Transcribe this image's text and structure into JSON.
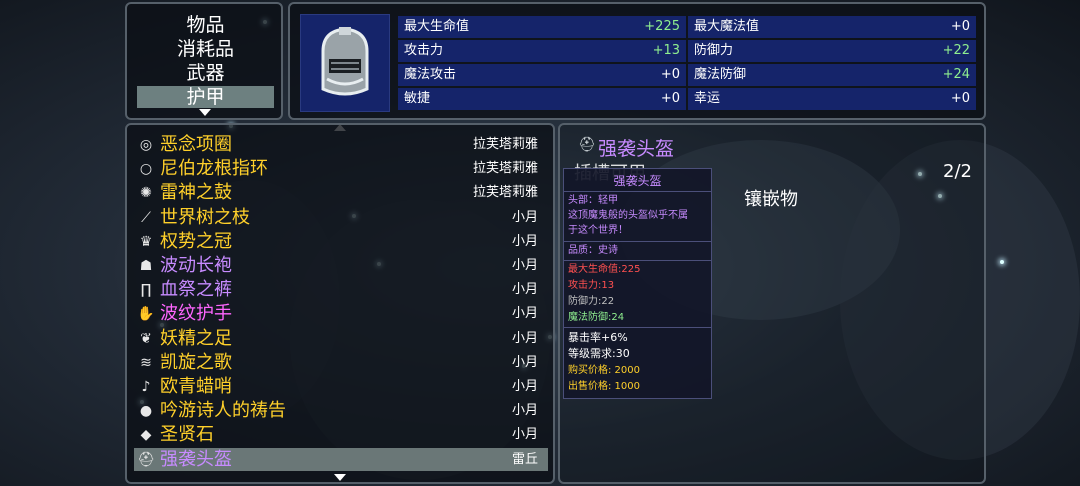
{
  "categories": {
    "items": [
      "物品",
      "消耗品",
      "武器",
      "护甲"
    ],
    "selected_index": 3
  },
  "stats": {
    "rows": [
      {
        "left_name": "最大生命值",
        "left_value": "+225",
        "right_name": "最大魔法值",
        "right_value": "+0"
      },
      {
        "left_name": "攻击力",
        "left_value": "+13",
        "right_name": "防御力",
        "right_value": "+22"
      },
      {
        "left_name": "魔法攻击",
        "left_value": "+0",
        "right_name": "魔法防御",
        "right_value": "+24"
      },
      {
        "left_name": "敏捷",
        "left_value": "+0",
        "right_name": "幸运",
        "right_value": "+0"
      }
    ]
  },
  "item_list": {
    "items": [
      {
        "name": "恶念项圈",
        "owner": "拉芙塔莉雅",
        "color": "#ffd02a",
        "icon": "collar-icon",
        "glyph": "◎"
      },
      {
        "name": "尼伯龙根指环",
        "owner": "拉芙塔莉雅",
        "color": "#ffd02a",
        "icon": "ring-icon",
        "glyph": "○"
      },
      {
        "name": "雷神之鼓",
        "owner": "拉芙塔莉雅",
        "color": "#ffd02a",
        "icon": "drum-icon",
        "glyph": "✺"
      },
      {
        "name": "世界树之枝",
        "owner": "小月",
        "color": "#ffd02a",
        "icon": "branch-icon",
        "glyph": "⟋"
      },
      {
        "name": "权势之冠",
        "owner": "小月",
        "color": "#ffd02a",
        "icon": "crown-icon",
        "glyph": "♛"
      },
      {
        "name": "波动长袍",
        "owner": "小月",
        "color": "#c78bff",
        "icon": "robe-icon",
        "glyph": "☗"
      },
      {
        "name": "血祭之裤",
        "owner": "小月",
        "color": "#c78bff",
        "icon": "pants-icon",
        "glyph": "∏"
      },
      {
        "name": "波纹护手",
        "owner": "小月",
        "color": "#ff66ff",
        "icon": "gauntlet-icon",
        "glyph": "✋"
      },
      {
        "name": "妖精之足",
        "owner": "小月",
        "color": "#ffd02a",
        "icon": "boots-icon",
        "glyph": "❦"
      },
      {
        "name": "凯旋之歌",
        "owner": "小月",
        "color": "#ffd02a",
        "icon": "scroll-icon",
        "glyph": "≋"
      },
      {
        "name": "欧青蜡哨",
        "owner": "小月",
        "color": "#ffd02a",
        "icon": "whistle-icon",
        "glyph": "♪"
      },
      {
        "name": "吟游诗人的祷告",
        "owner": "小月",
        "color": "#ffd02a",
        "icon": "orb-icon",
        "glyph": "●"
      },
      {
        "name": "圣贤石",
        "owner": "小月",
        "color": "#ffd02a",
        "icon": "stone-icon",
        "glyph": "◆"
      },
      {
        "name": "强袭头盔",
        "owner": "雷丘",
        "color": "#c78bff",
        "icon": "helmet-icon",
        "glyph": "⛑"
      }
    ],
    "selected_index": 13
  },
  "detail": {
    "item_name": "强袭头盔",
    "socket_label": "插槽可用",
    "socket_count": "2/2",
    "inlay_label": "镶嵌物",
    "name_color": "#c78bff"
  },
  "tooltip": {
    "title": "强袭头盔",
    "part": "头部：轻甲",
    "desc_1": "这顶魔鬼般的头盔似乎不属",
    "desc_2": "于这个世界！",
    "quality": "品质：史诗",
    "stat_1": "最大生命值:225",
    "stat_2": "攻击力:13",
    "stat_3": "防御力:22",
    "stat_4": "魔法防御:24",
    "crit": "暴击率+6%",
    "level": "等级需求:30",
    "buy": "购买价格:  2000",
    "sell": "出售价格:  1000"
  }
}
